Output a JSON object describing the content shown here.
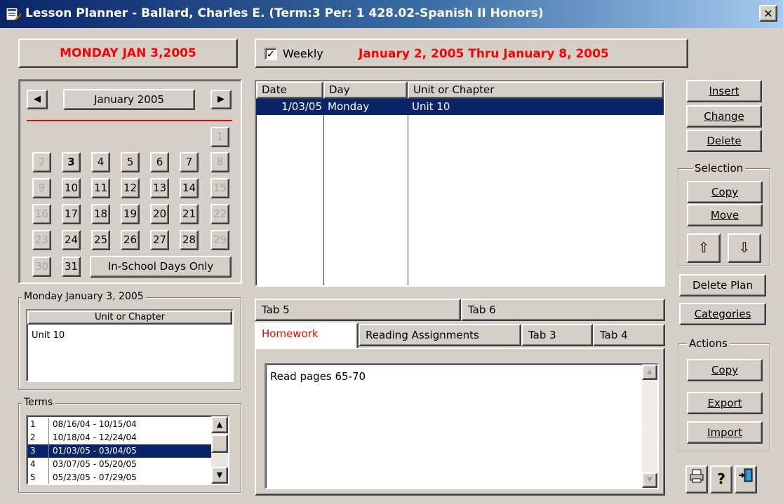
{
  "window": {
    "title": "Lesson Planner - Ballard, Charles E. (Term:3 Per: 1 428.02-Spanish II Honors)",
    "close_glyph": "✕"
  },
  "date_banner": "MONDAY JAN  3,2005",
  "weekly": {
    "checked": true,
    "label": "Weekly",
    "range": "January  2, 2005 Thru January  8, 2005"
  },
  "calendar": {
    "month_label": "January 2005",
    "prev_glyph": "◀",
    "next_glyph": "▶",
    "week1": [
      "1"
    ],
    "week2": [
      "2",
      "3",
      "4",
      "5",
      "6",
      "7",
      "8"
    ],
    "week3": [
      "9",
      "10",
      "11",
      "12",
      "13",
      "14",
      "15"
    ],
    "week4": [
      "16",
      "17",
      "18",
      "19",
      "20",
      "21",
      "22"
    ],
    "week5": [
      "23",
      "24",
      "25",
      "26",
      "27",
      "28",
      "29"
    ],
    "week6": [
      "30",
      "31"
    ],
    "in_school_only_label": "In-School Days Only"
  },
  "day_box": {
    "group_label": "Monday January  3, 2005",
    "header": "Unit or Chapter",
    "items": [
      "Unit 10"
    ]
  },
  "terms": {
    "group_label": "Terms",
    "rows": [
      {
        "num": "1",
        "range": "08/16/04 - 10/15/04"
      },
      {
        "num": "2",
        "range": "10/18/04 - 12/24/04"
      },
      {
        "num": "3",
        "range": "01/03/05 - 03/04/05"
      },
      {
        "num": "4",
        "range": "03/07/05 - 05/20/05"
      },
      {
        "num": "5",
        "range": "05/23/05 - 07/29/05"
      }
    ],
    "selected_index": 2
  },
  "plan_grid": {
    "columns": [
      "Date",
      "Day",
      "Unit or Chapter"
    ],
    "rows": [
      {
        "date": "1/03/05",
        "day": "Monday",
        "unit": "Unit 10"
      }
    ]
  },
  "tabs": {
    "row1": [
      "Tab 5",
      "Tab 6"
    ],
    "row2": [
      "Homework",
      "Reading Assignments",
      "Tab 3",
      "Tab 4"
    ],
    "active": "Homework",
    "content": "Read pages 65-70"
  },
  "buttons": {
    "insert": "Insert",
    "change": "Change",
    "delete": "Delete",
    "selection_label": "Selection",
    "copy": "Copy",
    "move": "Move",
    "delete_plan": "Delete Plan",
    "categories": "Categories",
    "actions_label": "Actions",
    "actions_copy": "Copy",
    "export": "Export",
    "import": "Import"
  },
  "icons": {
    "print": "printer-icon",
    "help": "help-icon",
    "exit": "exit-door-icon"
  }
}
